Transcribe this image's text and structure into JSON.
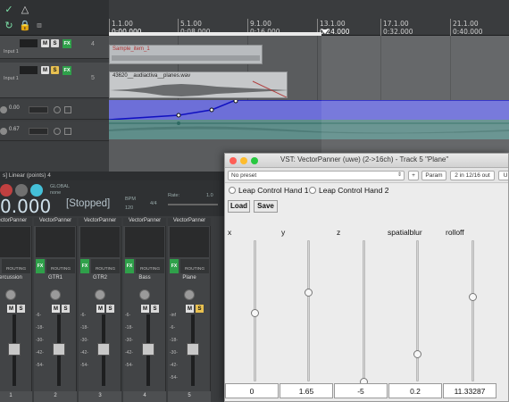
{
  "arrange": {
    "ruler": [
      {
        "bar": "1.1.00",
        "time": "0:00.000"
      },
      {
        "bar": "5.1.00",
        "time": "0:08.000"
      },
      {
        "bar": "9.1.00",
        "time": "0:16.000"
      },
      {
        "bar": "13.1.00",
        "time": "0:24.000"
      },
      {
        "bar": "17.1.00",
        "time": "0:32.000"
      },
      {
        "bar": "21.1.00",
        "time": "0:40.000"
      }
    ],
    "item1_title": "Sample_item_1",
    "item2_title": "43620__audiactiva__planes.wav",
    "envelope_values": [
      "0.00",
      "0.67"
    ]
  },
  "tracks": [
    {
      "num": "4",
      "io": "Input 1"
    },
    {
      "num": "5",
      "io": "Input 1"
    }
  ],
  "mixer": {
    "header": "s] Linear (points) 4",
    "time": "0.000",
    "status": "[Stopped]",
    "bpm_label": "BPM",
    "bpm": "120",
    "sig": "4/4",
    "rate_label": "Rate:",
    "rate": "1.0",
    "global_label": "GLOBAL",
    "global_mode": "none",
    "strips": [
      {
        "insert": "VectorPanner",
        "name": "ercussion",
        "num": "1"
      },
      {
        "insert": "VectorPanner",
        "name": "GTR1",
        "num": "2"
      },
      {
        "insert": "VectorPanner",
        "name": "GTR2",
        "num": "3"
      },
      {
        "insert": "VectorPanner",
        "name": "Bass",
        "num": "4"
      },
      {
        "insert": "VectorPanner",
        "name": "Plane",
        "num": "5"
      }
    ],
    "meter_ticks": [
      "-6-",
      "-18-",
      "-30-",
      "-42-",
      "-54-"
    ],
    "meter_ticks_plane": [
      "-inf",
      "-6-",
      "-18-",
      "-30-",
      "-42-",
      "-54-"
    ],
    "fx_label": "FX",
    "routing_label": "ROUTING"
  },
  "vst": {
    "title": "VST: VectorPanner (uwe) (2->16ch) - Track 5 \"Plane\"",
    "preset": "No preset",
    "plus": "+",
    "param": "Param",
    "io": "2 in 12/16 out",
    "extra": "UI",
    "radio1": "Leap Control Hand 1",
    "radio2": "Leap Control Hand 2",
    "load": "Load",
    "save": "Save",
    "channels": [
      {
        "label": "x",
        "value": "0",
        "level": 0.5
      },
      {
        "label": "y",
        "value": "1.65",
        "level": 0.65
      },
      {
        "label": "z",
        "value": "-5",
        "level": 0.0
      },
      {
        "label": "spatialblur",
        "value": "0.2",
        "level": 0.2
      },
      {
        "label": "rolloff",
        "value": "11.33287",
        "level": 0.62
      }
    ]
  }
}
